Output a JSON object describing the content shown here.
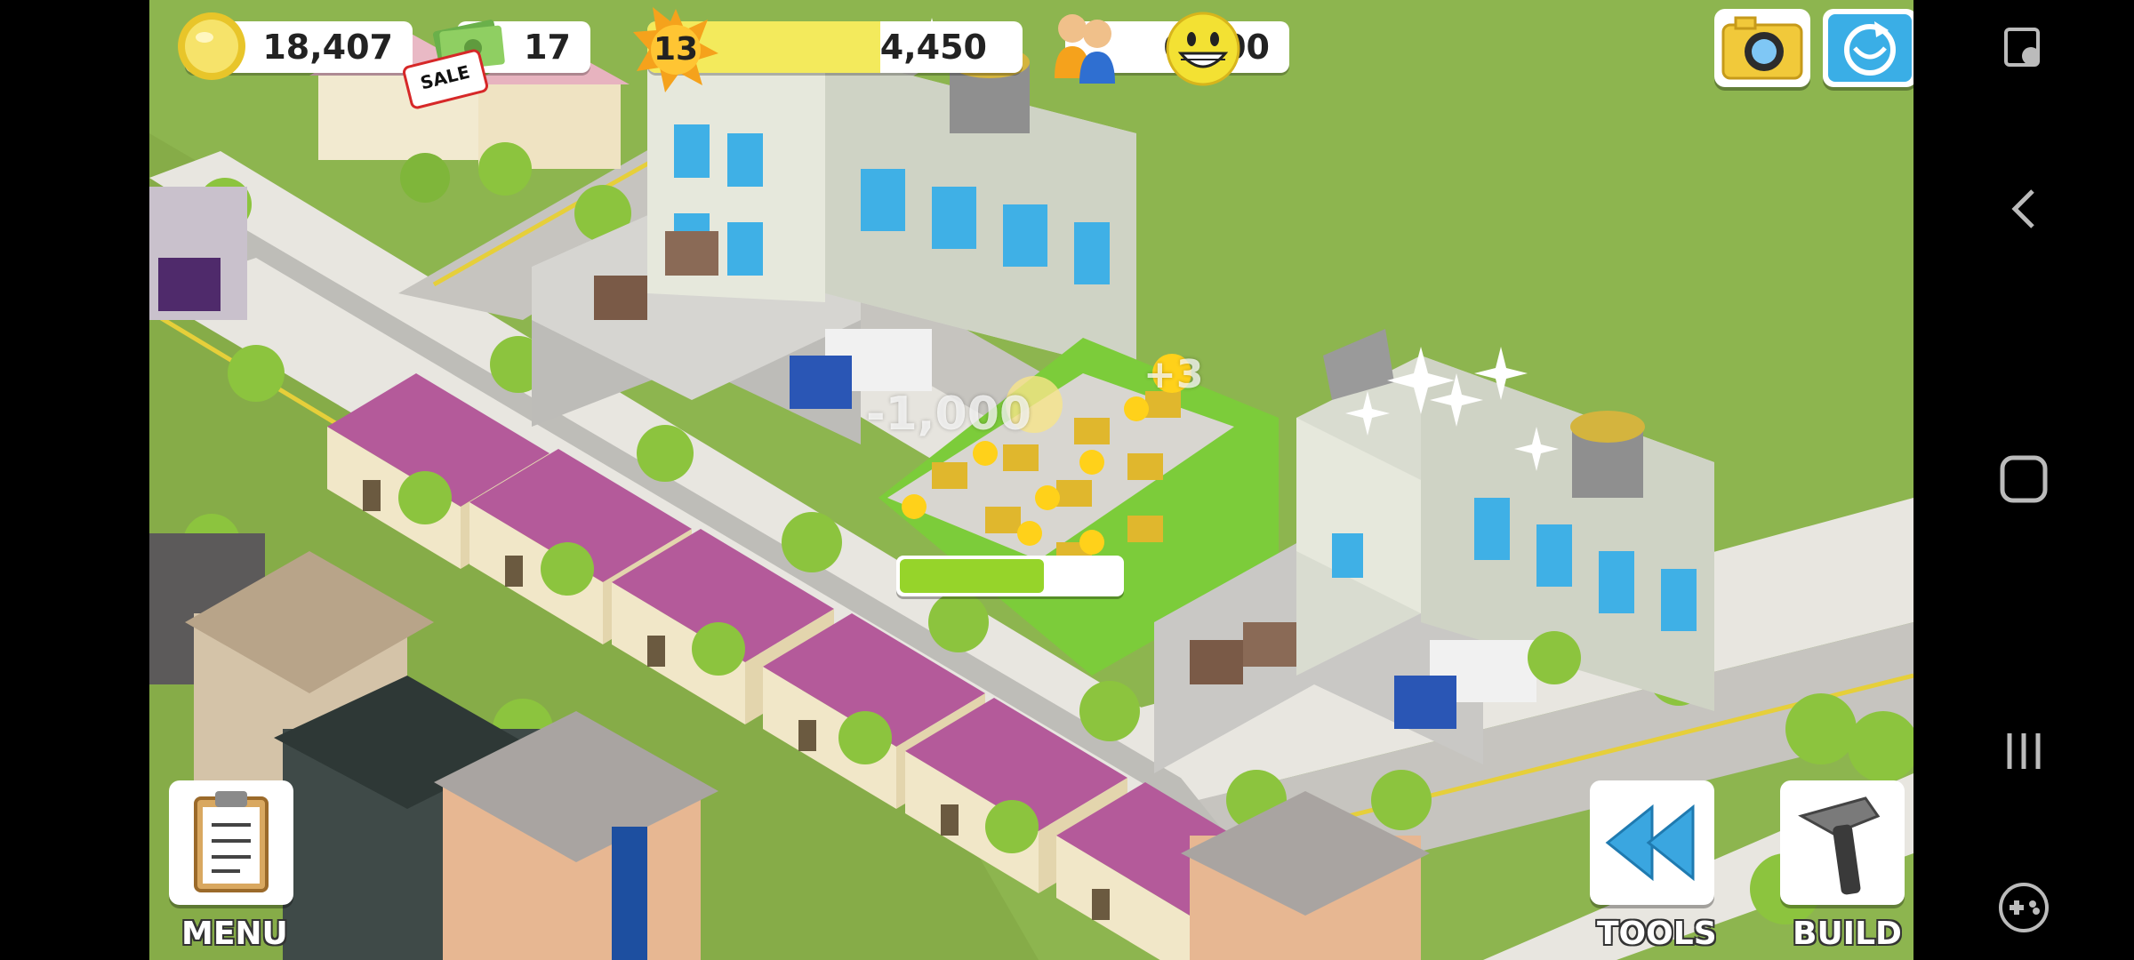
{
  "hud": {
    "coins": "18,407",
    "cash": "17",
    "level": "13",
    "xp": "4,450",
    "xp_progress": 0.62,
    "population": "6,600",
    "sale_tag": "SALE"
  },
  "floating": {
    "plus_three": "+3",
    "minus_cost": "-1,000"
  },
  "construction_progress": 0.65,
  "buttons": {
    "menu": "MENU",
    "tools": "TOOLS",
    "build": "BUILD"
  },
  "icons": {
    "coin": "coin-icon",
    "cash": "cash-icon",
    "level": "star-icon",
    "population": "population-icon",
    "happiness": "smiley-icon",
    "camera": "camera-icon",
    "share": "share-icon",
    "menu": "clipboard-icon",
    "tools": "rewind-icon",
    "build": "hammer-icon"
  },
  "colors": {
    "grass": "#8db54f",
    "xp_bar": "#f3ea5c",
    "progress_fill": "#96d42a",
    "roof": "#b45a9a"
  }
}
